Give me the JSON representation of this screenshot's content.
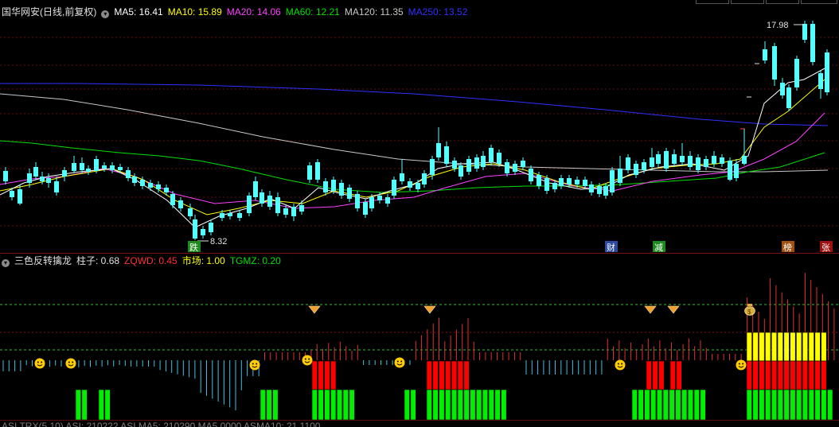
{
  "main_header": {
    "title": "国华网安(日线,前复权)",
    "ma5": "MA5: 16.41",
    "ma10": "MA10: 15.89",
    "ma20": "MA20: 14.06",
    "ma60": "MA60: 12.21",
    "ma120": "MA120: 11.35",
    "ma250": "MA250: 13.52"
  },
  "price_labels": {
    "high": "17.98",
    "low": "8.32"
  },
  "event_tags": [
    {
      "text": "跌",
      "color": "#1e8a1e"
    },
    {
      "text": "财",
      "color": "#2a4aa0"
    },
    {
      "text": "减",
      "color": "#1e8a1e"
    },
    {
      "text": "榜",
      "color": "#a05010"
    },
    {
      "text": "张",
      "color": "#a01010"
    }
  ],
  "sub_header": {
    "title": "三色反转擒龙",
    "zhuzi": "柱子: 0.68",
    "zqwd": "ZQWD: 0.45",
    "shichang": "市场: 1.00",
    "tgmz": "TGMZ: 0.20"
  },
  "bottom_header": {
    "text": "ASI TRX(5,10) ASI: 210222 ASI MA5: 210290 MA5 0000 ASMA10: 21 1100"
  },
  "colors": {
    "up": "#ff3232",
    "down": "#54ffff",
    "ma5": "#ffffff",
    "ma10": "#ffff00",
    "ma20": "#ff40ff",
    "ma60": "#00e000",
    "ma120": "#c8c8c8",
    "ma250": "#3030ff",
    "yellow_bar": "#ffff00",
    "red_bar": "#ff0000",
    "green_bar": "#00ee00"
  }
}
